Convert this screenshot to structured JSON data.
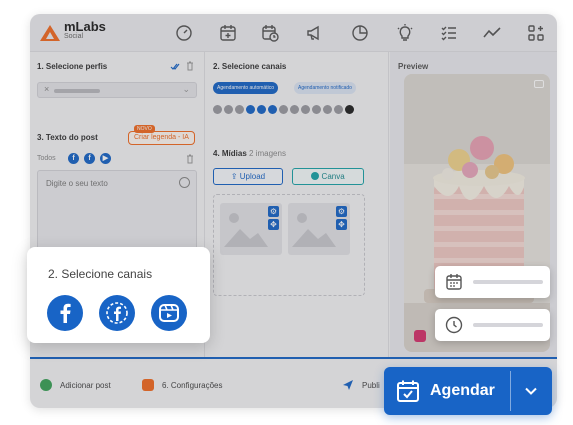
{
  "app": {
    "logo_name": "mLabs",
    "logo_sub": "Social"
  },
  "topbar_icons": [
    "dashboard-icon",
    "calendar-add-icon",
    "calendar-clock-icon",
    "megaphone-icon",
    "pie-chart-icon",
    "lightbulb-icon",
    "checklist-icon",
    "trend-line-icon",
    "apps-add-icon"
  ],
  "col1": {
    "step1_title": "1. Selecione perfis",
    "step3_title": "3. Texto do post",
    "new_badge": "NOVO",
    "ai_button": "Criar legenda - IA",
    "tab_all": "Todos",
    "text_placeholder": "Digite o seu texto"
  },
  "col2": {
    "step2_title": "2. Selecione canais",
    "chip_auto": "Agendamento automático",
    "chip_notify": "Agendamento notificado",
    "step4_title": "4. Mídias",
    "media_count": "2 imagens",
    "upload_label": "Upload",
    "canva_label": "Canva"
  },
  "col3": {
    "preview_label": "Preview"
  },
  "bottombar": {
    "add_post": "Adicionar post",
    "settings": "6. Configurações",
    "publish": "Publi"
  },
  "popup": {
    "title": "2. Selecione canais",
    "channels": [
      "facebook-icon",
      "facebook-outline-icon",
      "facebook-reels-icon"
    ]
  },
  "cta": {
    "label": "Agendar"
  },
  "colors": {
    "brand_blue": "#1864c6",
    "brand_orange": "#f26b21",
    "canva_teal": "#1aa3a8"
  }
}
